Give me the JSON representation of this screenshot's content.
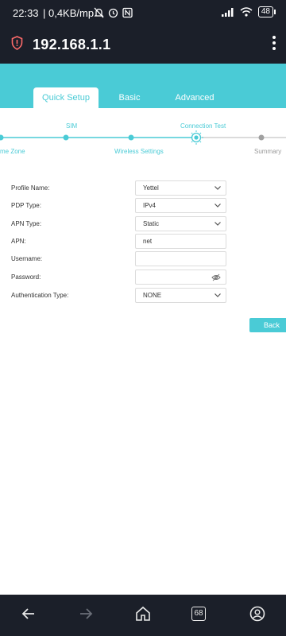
{
  "status_bar": {
    "time": "22:33",
    "net_speed": "| 0,4KB/mp",
    "battery": "48",
    "icons": [
      "mute-bell-icon",
      "alarm-icon",
      "nfc-icon",
      "signal-icon",
      "wifi-icon",
      "battery-icon"
    ]
  },
  "browser": {
    "url": "192.168.1.1",
    "tab_count": "68",
    "icons": [
      "security-shield-icon",
      "menu-kebab-icon",
      "back-arrow-icon",
      "forward-arrow-icon",
      "home-icon",
      "tabs-icon",
      "profile-icon"
    ]
  },
  "tabs": [
    {
      "label": "Quick Setup",
      "active": true
    },
    {
      "label": "Basic",
      "active": false
    },
    {
      "label": "Advanced",
      "active": false
    }
  ],
  "steps": {
    "top": [
      "SIM",
      "Connection Test"
    ],
    "bottom": [
      "me Zone",
      "Wireless Settings",
      "Summary"
    ]
  },
  "form": {
    "profile_name": {
      "label": "Profile Name:",
      "value": "Yettel"
    },
    "pdp_type": {
      "label": "PDP Type:",
      "value": "IPv4"
    },
    "apn_type": {
      "label": "APN Type:",
      "value": "Static"
    },
    "apn": {
      "label": "APN:",
      "value": "net"
    },
    "username": {
      "label": "Username:",
      "value": ""
    },
    "password": {
      "label": "Password:",
      "value": ""
    },
    "auth_type": {
      "label": "Authentication Type:",
      "value": "NONE"
    }
  },
  "back_button": "Back",
  "colors": {
    "accent": "#4acbd6",
    "bar_dark": "#1b1f29",
    "inactive_step": "#9a9a9a"
  }
}
